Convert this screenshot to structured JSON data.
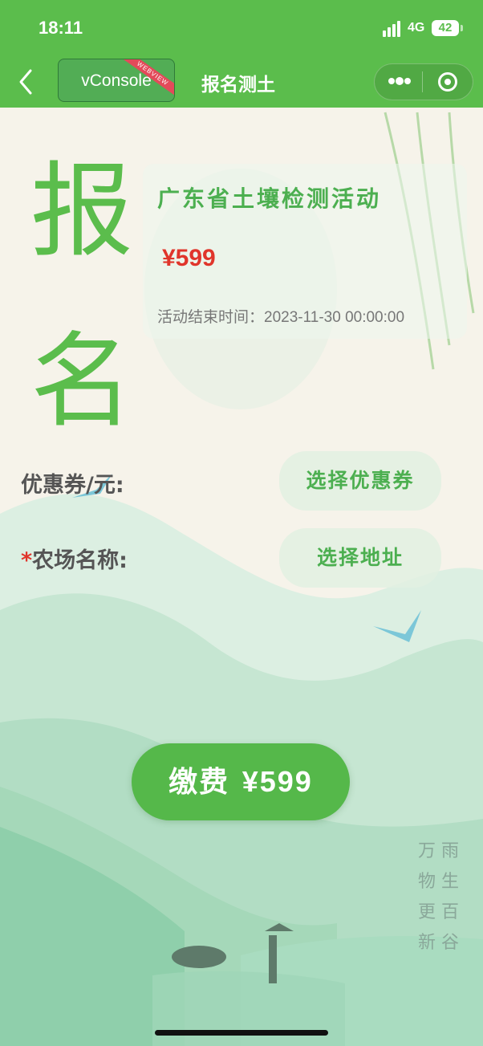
{
  "status_bar": {
    "time": "18:11",
    "network": "4G",
    "battery": "42"
  },
  "nav": {
    "vconsole_label": "vConsole",
    "vconsole_badge": "WEBVIEW",
    "title": "报名测土"
  },
  "hero": {
    "char1": "报",
    "char2": "名"
  },
  "activity": {
    "name": "广东省土壤检测活动",
    "price": "¥599",
    "end_time_label": "活动结束时间：",
    "end_time_value": "2023-11-30 00:00:00"
  },
  "form": {
    "coupon_label": "优惠券/元:",
    "coupon_button": "选择优惠券",
    "farm_required_mark": "*",
    "farm_label": "农场名称:",
    "farm_button": "选择地址"
  },
  "pay": {
    "label": "缴费",
    "amount": "¥599"
  },
  "poem": {
    "col1": "雨生百谷",
    "col2": "万物更新"
  },
  "colors": {
    "brand_green": "#5bbd4c",
    "price_red": "#e0352b"
  },
  "icons": [
    "back-chevron-icon",
    "more-dots-icon",
    "close-target-icon",
    "signal-icon",
    "battery-icon"
  ]
}
